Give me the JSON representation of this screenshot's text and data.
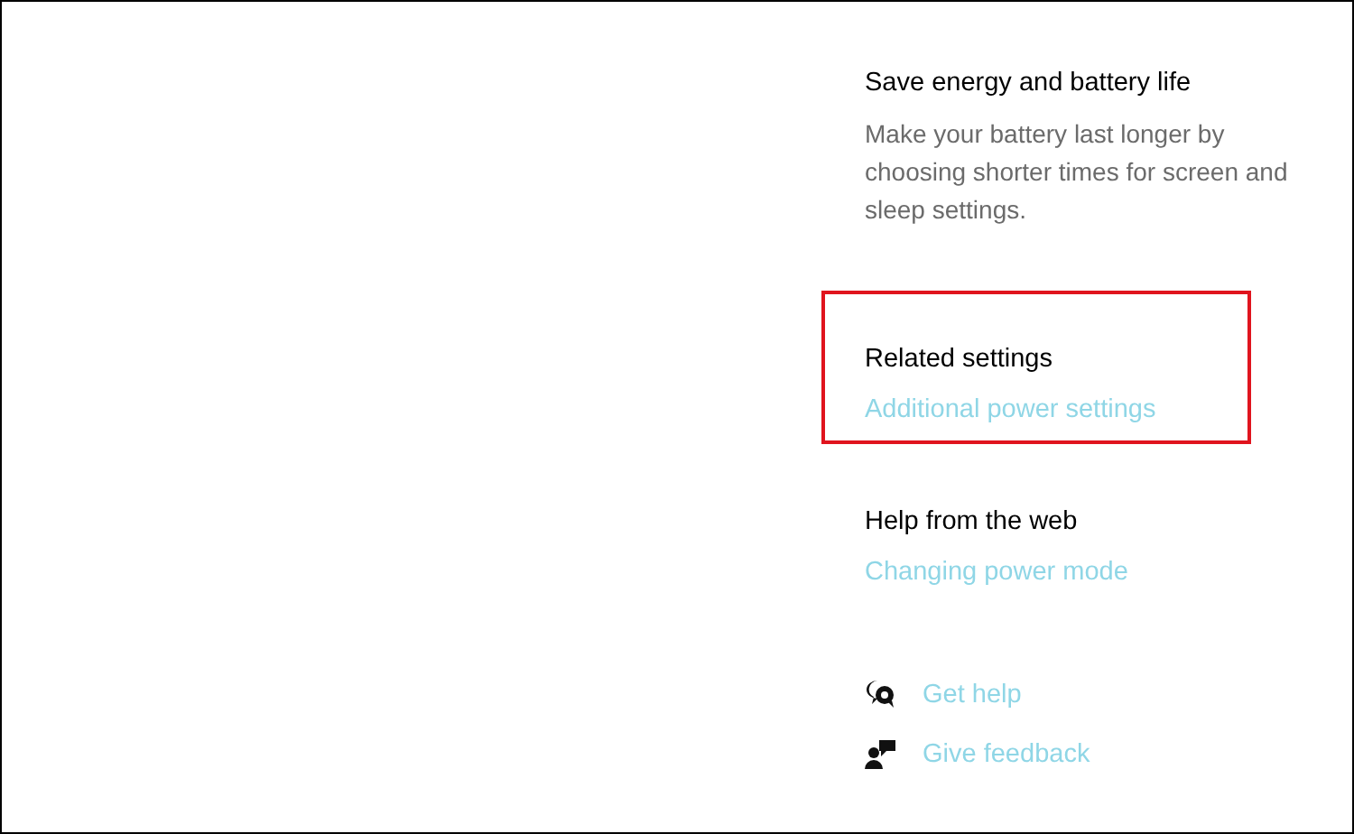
{
  "sections": [
    {
      "heading": "Save energy and battery life",
      "description": "Make your battery last longer by choosing shorter times for screen and sleep settings.",
      "highlighted": false
    },
    {
      "heading": "Related settings",
      "links": [
        "Additional power settings"
      ],
      "highlighted": true
    },
    {
      "heading": "Help from the web",
      "links": [
        "Changing power mode"
      ],
      "highlighted": false
    }
  ],
  "help_links": [
    {
      "kind": "help",
      "label": "Get help"
    },
    {
      "kind": "feedback",
      "label": "Give feedback"
    }
  ]
}
